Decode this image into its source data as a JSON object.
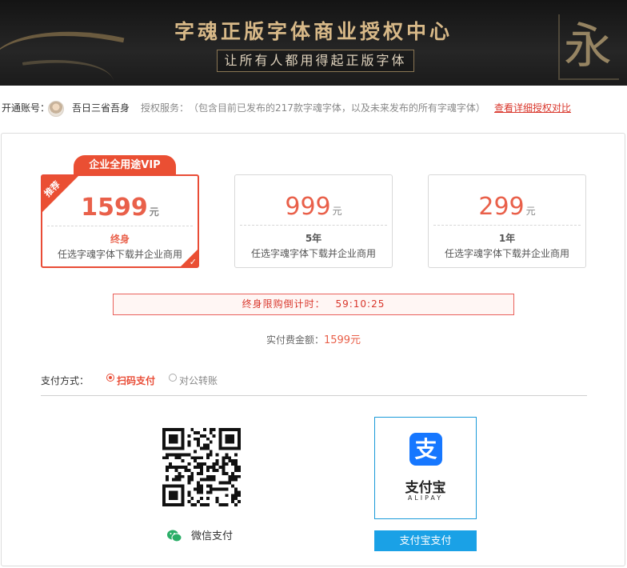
{
  "banner": {
    "title": "字魂正版字体商业授权中心",
    "subtitle": "让所有人都用得起正版字体",
    "glyph": "永"
  },
  "account": {
    "label": "开通账号：",
    "username": "吾日三省吾身",
    "service_label": "授权服务：",
    "service_desc": "（包含目前已发布的217款字魂字体，以及未来发布的所有字魂字体）",
    "detail_link": "查看详细授权对比"
  },
  "plans": {
    "vip_tag": "企业全用途VIP",
    "recommend_badge": "推荐",
    "unit": "元",
    "items": [
      {
        "price": "1599",
        "term": "终身",
        "desc": "任选字魂字体下载并企业商用",
        "selected": true
      },
      {
        "price": "999",
        "term": "5年",
        "desc": "任选字魂字体下载并企业商用",
        "selected": false
      },
      {
        "price": "299",
        "term": "1年",
        "desc": "任选字魂字体下载并企业商用",
        "selected": false
      }
    ]
  },
  "countdown": {
    "label": "终身限购倒计时：",
    "time": "59:10:25"
  },
  "amount": {
    "label": "实付费金额：",
    "value": "1599元"
  },
  "payment": {
    "label": "支付方式：",
    "options": [
      "扫码支付",
      "对公转账"
    ],
    "selected": "扫码支付",
    "wechat_label": "微信支付",
    "alipay_name": "支付宝",
    "alipay_en": "ALIPAY",
    "alipay_logo_char": "支",
    "alipay_button": "支付宝支付"
  },
  "colors": {
    "accent": "#e94c36",
    "alipay_blue": "#1677ff",
    "wechat_green": "#2aae67"
  }
}
